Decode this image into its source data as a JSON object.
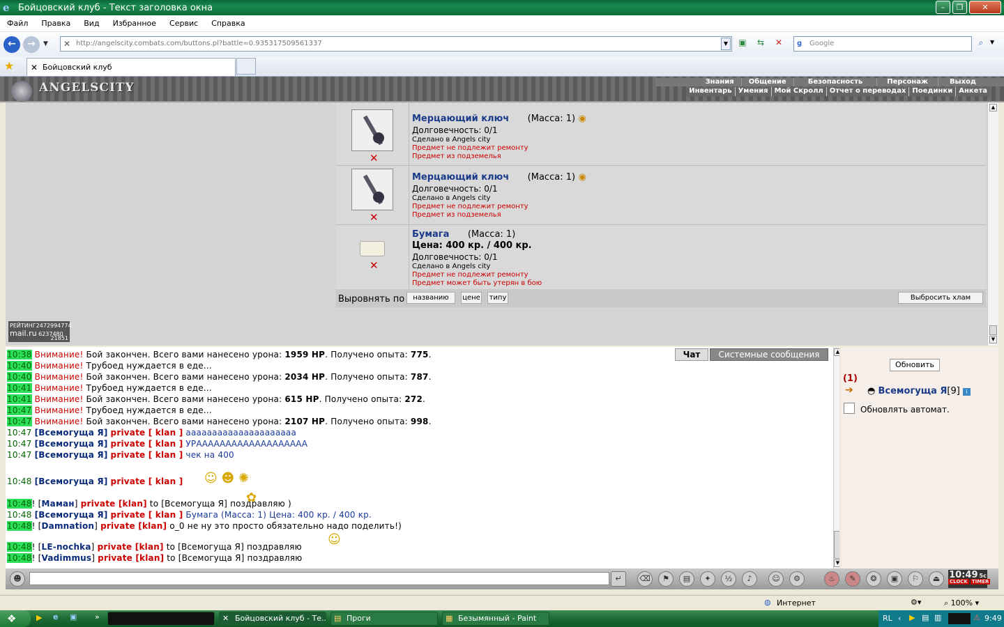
{
  "window": {
    "title": "Бойцовский клуб - Текст заголовка окна"
  },
  "menu": [
    "Файл",
    "Правка",
    "Вид",
    "Избранное",
    "Сервис",
    "Справка"
  ],
  "address": {
    "url": "http://angelscity.combats.com/buttons.pl?battle=0.935317509561337",
    "search_placeholder": "Google"
  },
  "tabs": {
    "active": "Бойцовский клуб"
  },
  "site": {
    "logo": "ANGELSCITY",
    "nav_top": [
      "Знания",
      "Общение",
      "Безопасность",
      "Персонаж",
      "Выход"
    ],
    "nav_bottom": [
      "Инвентарь",
      "Умения",
      "Мой Скролл",
      "Отчет о переводах",
      "Поединки",
      "Анкета"
    ]
  },
  "items": [
    {
      "name": "Мерцающий ключ",
      "mass": "(Масса: 1)",
      "durability": "Долговечность: 0/1",
      "made": "Сделано в Angels city",
      "note1": "Предмет не подлежит ремонту",
      "note2": "Предмет из подземелья"
    },
    {
      "name": "Мерцающий ключ",
      "mass": "(Масса: 1)",
      "durability": "Долговечность: 0/1",
      "made": "Сделано в Angels city",
      "note1": "Предмет не подлежит ремонту",
      "note2": "Предмет из подземелья"
    },
    {
      "name": "Бумага",
      "mass": "(Масса: 1)",
      "price": "Цена: 400 кр. / 400 кр.",
      "durability": "Долговечность: 0/1",
      "made": "Сделано в Angels city",
      "note1": "Предмет не подлежит ремонту",
      "note2": "Предмет может быть утерян в бою"
    }
  ],
  "sort": {
    "label": "Выровнять по",
    "by_name": "названию",
    "by_price": "цене",
    "by_type": "типу",
    "discard": "Выбросить хлам"
  },
  "rating": {
    "label": "РЕЙТИНГ",
    "v1": "2472994774",
    "v2": "6237480",
    "v3": "21851",
    "brand": "mail.ru"
  },
  "chat": {
    "tab_chat": "Чат",
    "tab_system": "Системные сообщения",
    "system": [
      {
        "t": "10:38",
        "w": "Внимание!",
        "a": "Бой закончен. Всего вами нанесено урона:",
        "hp": "1959 HP",
        "b": ". Получено опыта:",
        "xp": "775",
        "c": "."
      },
      {
        "t": "10:40",
        "w": "Внимание!",
        "msg": "Трубоед нуждается в еде..."
      },
      {
        "t": "10:40",
        "w": "Внимание!",
        "a": "Бой закончен. Всего вами нанесено урона:",
        "hp": "2034 HP",
        "b": ". Получено опыта:",
        "xp": "787",
        "c": "."
      },
      {
        "t": "10:41",
        "w": "Внимание!",
        "msg": "Трубоед нуждается в еде..."
      },
      {
        "t": "10:41",
        "w": "Внимание!",
        "a": "Бой закончен. Всего вами нанесено урона:",
        "hp": "615 HP",
        "b": ". Получено опыта:",
        "xp": "272",
        "c": "."
      },
      {
        "t": "10:47",
        "w": "Внимание!",
        "msg": "Трубоед нуждается в еде..."
      },
      {
        "t": "10:47",
        "w": "Внимание!",
        "a": "Бой закончен. Всего вами нанесено урона:",
        "hp": "2107 HP",
        "b": ". Получено опыта:",
        "xp": "998",
        "c": "."
      }
    ],
    "private": [
      {
        "t": "10:47",
        "nick": "[Всемогуща Я]",
        "tag": "private [ klan ]",
        "msg": "ааааааааааааааааааааа"
      },
      {
        "t": "10:47",
        "nick": "[Всемогуща Я]",
        "tag": "private [ klan ]",
        "msg": "УРААААААААААААААААААА"
      },
      {
        "t": "10:47",
        "nick": "[Всемогуща Я]",
        "tag": "private [ klan ]",
        "msg": "чек на 400"
      },
      {
        "t": "10:48",
        "nick": "[Всемогуща Я]",
        "tag": "private [ klan ]",
        "msg": ""
      }
    ],
    "other": [
      {
        "t": "10:48",
        "pre": "! [",
        "nick": "Маман",
        "post": "]",
        "tag": "private [klan]",
        "to": "to [Всемогуща Я]",
        "msg": "поздравляю )"
      },
      {
        "t": "10:48",
        "nick": "[Всемогуща Я]",
        "tag": "private [ klan ]",
        "msg": "Бумага (Масса: 1) Цена: 400 кр. / 400 кр."
      },
      {
        "t": "10:48",
        "pre": "! [",
        "nick": "Damnation",
        "post": "]",
        "tag": "private [klan]",
        "to": "",
        "msg": "o_0 не ну это просто обязательно надо поделить!)"
      },
      {
        "t": "10:48",
        "pre": "! [",
        "nick": "LE-nochka",
        "post": "]",
        "tag": "private [klan]",
        "to": "to [Всемогуща Я]",
        "msg": "поздравляю"
      },
      {
        "t": "10:48",
        "pre": "! [",
        "nick": "Vadimmus",
        "post": "]",
        "tag": "private [klan]",
        "to": "to [Всемогуща Я]",
        "msg": "поздравляю"
      }
    ]
  },
  "side": {
    "refresh": "Обновить",
    "count": "(1)",
    "user": "Всемогуща Я",
    "level": "[9]",
    "auto": "Обновлять автомат."
  },
  "clock": {
    "time": "10:49",
    "sec": "5с",
    "l1": "CLOCK",
    "l2": "TIMER"
  },
  "status": {
    "zone": "Интернет",
    "zoom": "100%"
  },
  "taskbar": {
    "tasks": [
      "Бойцовский клуб - Те...",
      "Проги",
      "Безымянный - Paint"
    ],
    "lang": "RL",
    "time": "9:49"
  }
}
